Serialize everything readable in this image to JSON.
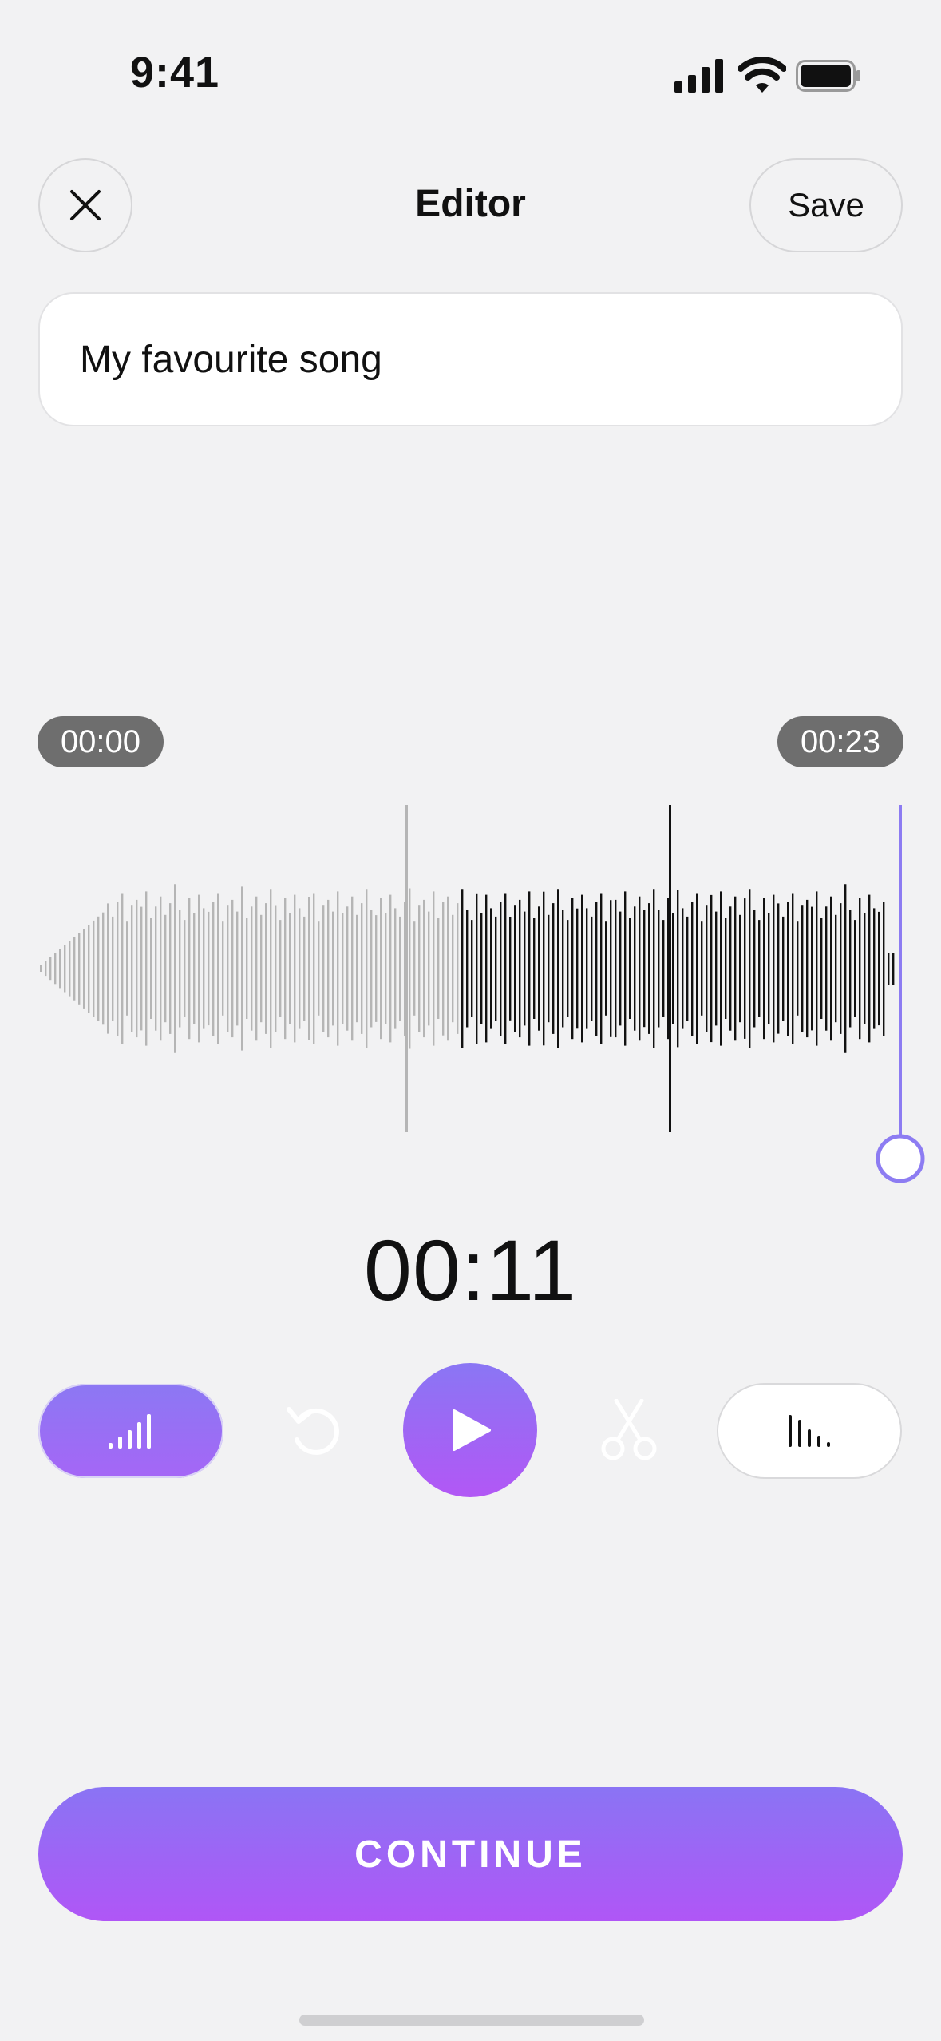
{
  "status_bar": {
    "time": "9:41"
  },
  "header": {
    "title": "Editor",
    "save_label": "Save"
  },
  "name_field": {
    "value": "My favourite song"
  },
  "timeline": {
    "start": "00:00",
    "end": "00:23",
    "current": "00:11"
  },
  "playhead_fraction": 1.0,
  "actions": {
    "continue_label": "CONTINUE"
  },
  "colors": {
    "accent_start": "#8a76f4",
    "accent_end": "#b257f5",
    "played_wave": "#b5b5b5",
    "upcoming_wave": "#111111",
    "playhead": "#8d7cf2"
  },
  "icons": {
    "close": "close-icon",
    "level": "signal-bars-icon",
    "undo": "undo-icon",
    "play": "play-icon",
    "cut": "scissors-icon",
    "waveform": "waveform-icon"
  }
}
